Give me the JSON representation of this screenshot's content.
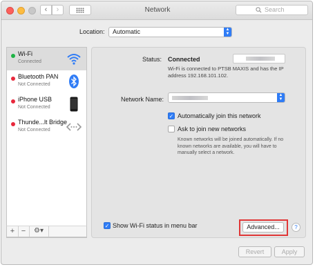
{
  "window": {
    "title": "Network"
  },
  "toolbar": {
    "search_placeholder": "Search"
  },
  "location": {
    "label": "Location:",
    "value": "Automatic"
  },
  "services": [
    {
      "name": "Wi-Fi",
      "status": "Connected",
      "dot_color": "#1db344",
      "icon": "wifi-icon"
    },
    {
      "name": "Bluetooth PAN",
      "status": "Not Connected",
      "dot_color": "#e8283c",
      "icon": "bluetooth-icon"
    },
    {
      "name": "iPhone USB",
      "status": "Not Connected",
      "dot_color": "#e8283c",
      "icon": "iphone-icon"
    },
    {
      "name": "Thunde...lt Bridge",
      "status": "Not Connected",
      "dot_color": "#e8283c",
      "icon": "thunderbolt-bridge-icon"
    }
  ],
  "sidebar_tools": {
    "add": "+",
    "remove": "−",
    "gear": "⚙▾"
  },
  "status": {
    "label": "Status:",
    "value": "Connected",
    "description": "Wi-Fi is connected to PTSB MAXIS and has the IP address 192.168.101.102."
  },
  "network_name": {
    "label": "Network Name:"
  },
  "auto_join": {
    "label": "Automatically join this network",
    "checked": true
  },
  "ask_join": {
    "label": "Ask to join new networks",
    "checked": false
  },
  "hint": "Known networks will be joined automatically. If no known networks are available, you will have to manually select a network.",
  "show_wifi_status": {
    "label": "Show Wi-Fi status in menu bar",
    "checked": true
  },
  "buttons": {
    "advanced": "Advanced...",
    "help": "?",
    "revert": "Revert",
    "apply": "Apply"
  },
  "colors": {
    "accent": "#2f7cf6",
    "highlight": "#e03636"
  }
}
